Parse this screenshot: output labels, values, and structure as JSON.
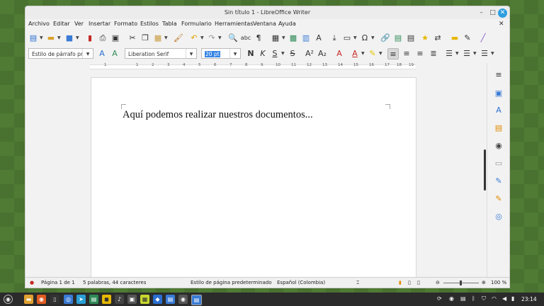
{
  "window": {
    "title": "Sin título 1 - LibreOffice Writer"
  },
  "menu": [
    "Archivo",
    "Editar",
    "Ver",
    "Insertar",
    "Formato",
    "Estilos",
    "Tabla",
    "Formulario",
    "Herramientas",
    "Ventana",
    "Ayuda"
  ],
  "formatting": {
    "paragraph_style": "Estilo de párrafo pr",
    "font_name": "Liberation Serif",
    "font_size": "20 pt"
  },
  "ruler": {
    "numbers": [
      "1",
      "1",
      "2",
      "3",
      "4",
      "5",
      "6",
      "7",
      "8",
      "9",
      "10",
      "11",
      "12",
      "13",
      "14",
      "15",
      "16",
      "17",
      "18",
      "19"
    ]
  },
  "document": {
    "text": "Aquí podemos realizar nuestros documentos..."
  },
  "status": {
    "page": "Página 1 de 1",
    "words": "5 palabras, 44 caracteres",
    "page_style": "Estilo de página predeterminado",
    "language": "Español (Colombia)",
    "zoom": "100 %"
  },
  "taskbar": {
    "clock": "23:14"
  },
  "colors": {
    "accent": "#3584e4",
    "close": "#2d9ee0",
    "desktop": "#4f7b34",
    "taskbar": "#2b2b2b"
  }
}
